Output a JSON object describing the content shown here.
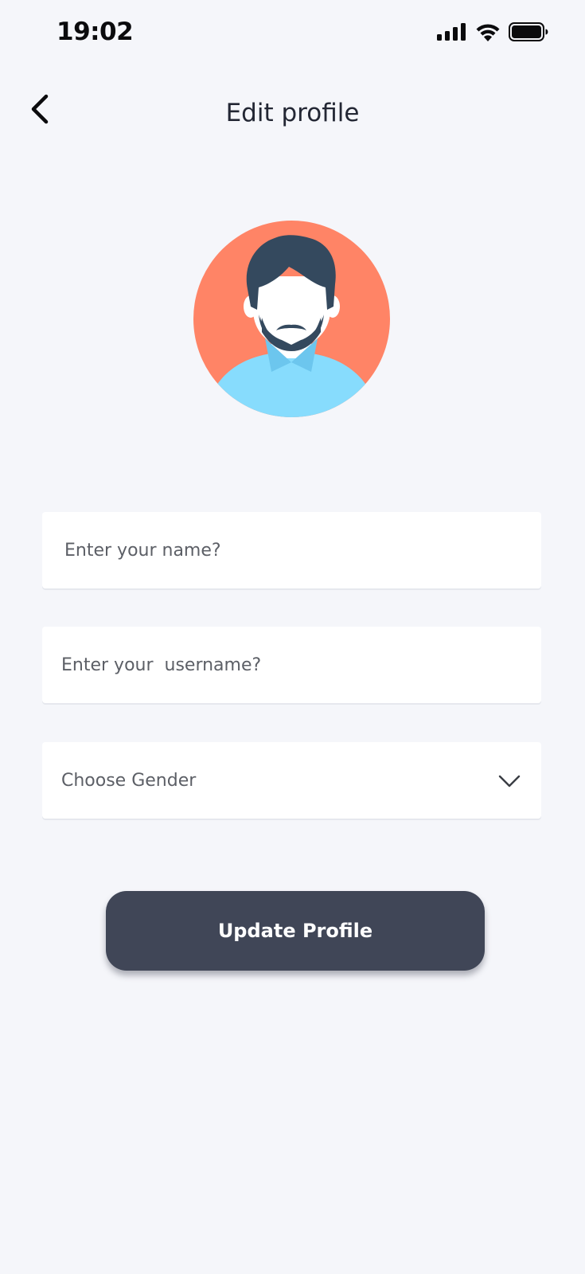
{
  "status_bar": {
    "time": "19:02",
    "icons": [
      "cellular-signal-icon",
      "wifi-icon",
      "battery-icon"
    ]
  },
  "header": {
    "back_icon": "chevron-left-icon",
    "title": "Edit profile"
  },
  "profile": {
    "avatar_icon": "user-avatar-icon",
    "colors": {
      "background": "#ff8466",
      "hair": "#34495e",
      "shirt": "#87dcfd"
    }
  },
  "form": {
    "name_placeholder": "Enter your name?",
    "username_placeholder": "Enter your  username?",
    "gender_placeholder": "Choose Gender",
    "gender_icon": "chevron-down-icon"
  },
  "actions": {
    "update_label": "Update Profile"
  },
  "colors": {
    "page_background": "#f5f6fa",
    "button_background": "#404657",
    "field_background": "#ffffff"
  }
}
